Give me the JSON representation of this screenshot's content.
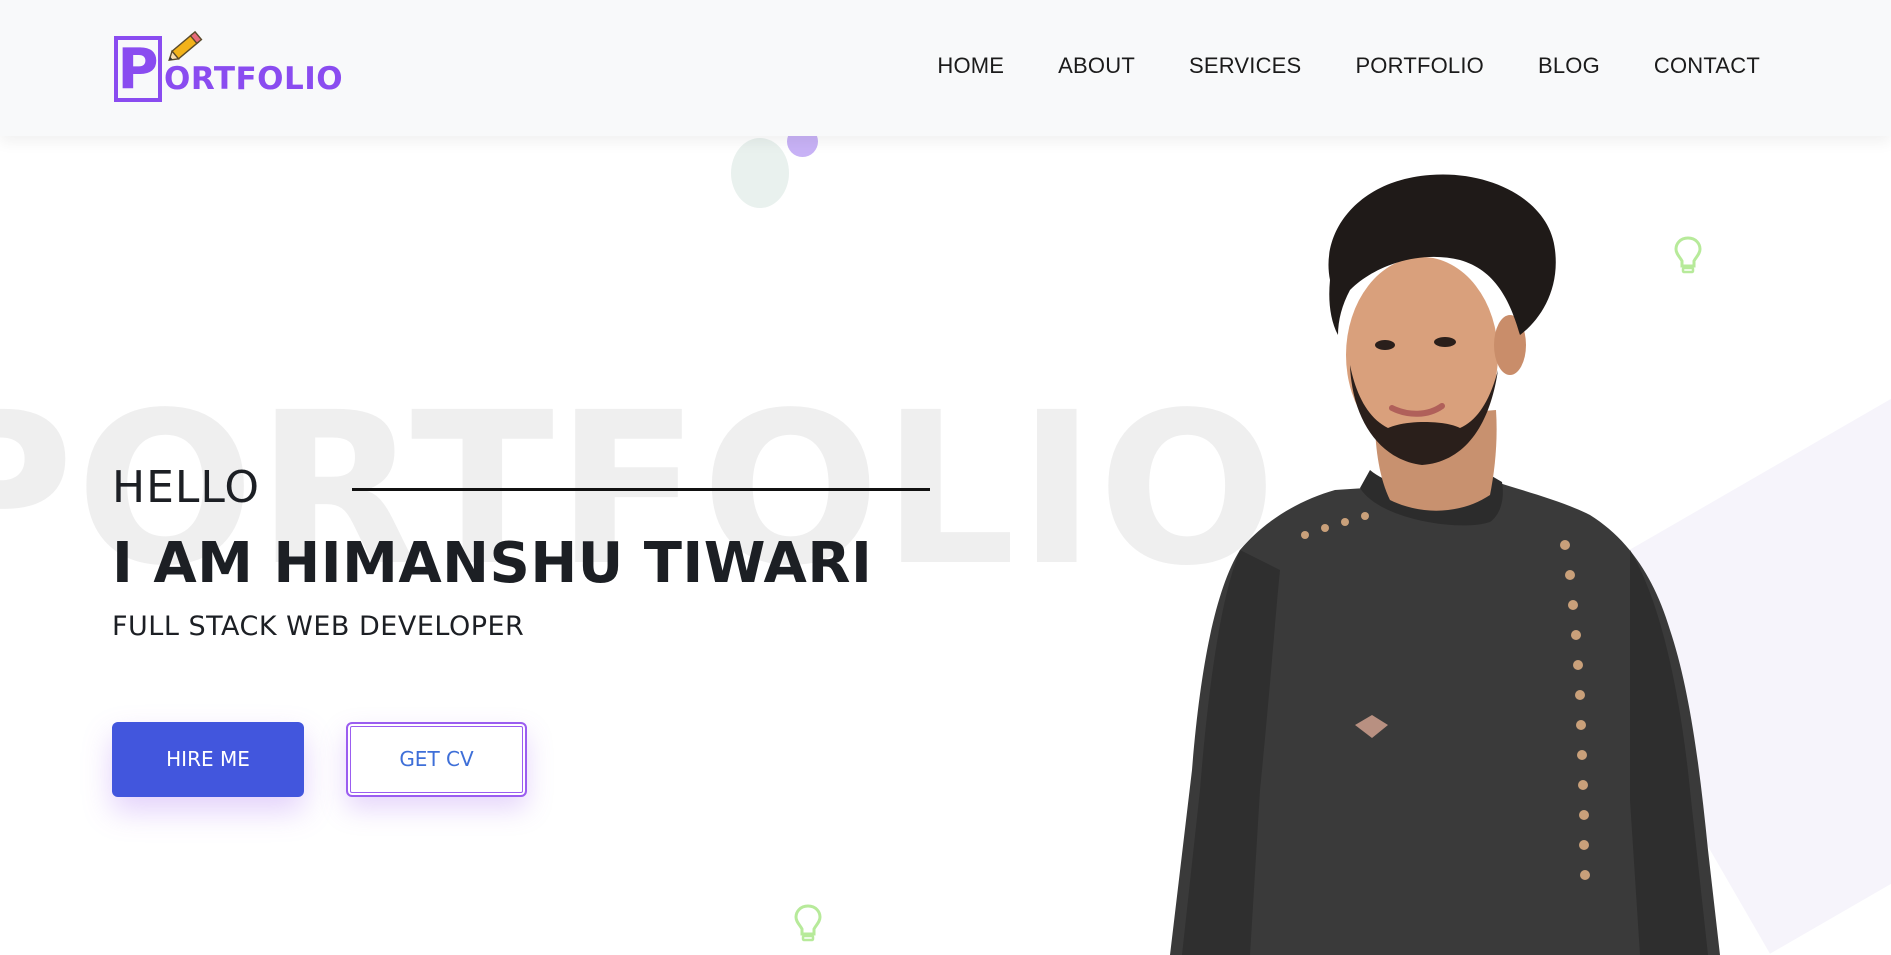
{
  "header": {
    "logo": {
      "text": "PORTFOLIO",
      "initial": "P",
      "rest": "ORTFOLIO"
    },
    "nav": [
      "HOME",
      "ABOUT",
      "SERVICES",
      "PORTFOLIO",
      "BLOG",
      "CONTACT"
    ]
  },
  "hero": {
    "watermark": "PORTFOLIO",
    "greeting": "HELLO",
    "name": "I AM HIMANSHU TIWARI",
    "role": "FULL STACK WEB DEVELOPER",
    "hire_label": "HIRE ME",
    "cv_label": "GET CV"
  },
  "colors": {
    "brand": "#8a4cf0",
    "primary_button": "#4256dd",
    "outline_button": "#9b5df0",
    "bulb": "#b7ea9a"
  },
  "icons": [
    "pencil-icon",
    "lightbulb-icon"
  ]
}
